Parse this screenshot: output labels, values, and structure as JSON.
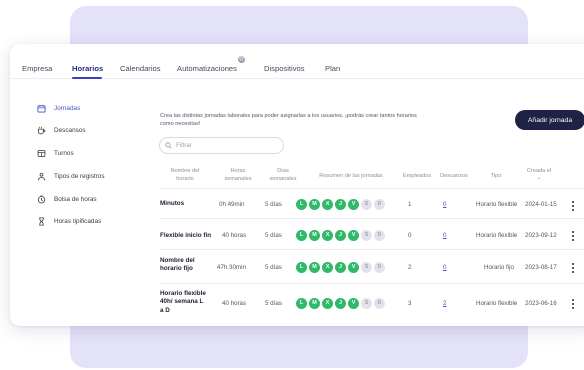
{
  "nav": {
    "tabs": [
      {
        "label": "Empresa"
      },
      {
        "label": "Horarios"
      },
      {
        "label": "Calendarios"
      },
      {
        "label": "Automatizaciones"
      },
      {
        "label": "Dispositivos"
      },
      {
        "label": "Plan"
      }
    ],
    "active_tab": "Horarios",
    "automatizaciones_badge": "@"
  },
  "sidebar": {
    "items": [
      {
        "label": "Jornadas",
        "icon": "calendar-icon"
      },
      {
        "label": "Descansos",
        "icon": "coffee-icon"
      },
      {
        "label": "Turnos",
        "icon": "grid-icon"
      },
      {
        "label": "Tipos de registros",
        "icon": "people-icon"
      },
      {
        "label": "Bolsa de horas",
        "icon": "clock-icon"
      },
      {
        "label": "Horas tipificadas",
        "icon": "hourglass-icon"
      }
    ],
    "active_item": "Jornadas"
  },
  "main": {
    "intro_text": "Crea las distintas jornadas laborales para poder asignarlas a los usuarios, ¡podrás crear tantos horarios como necesitas!",
    "add_button": "Añadir jornada",
    "search_placeholder": "Filtrar",
    "columns": {
      "name": "Nombre del horario",
      "hours": "Horas semanales",
      "days": "Días semanales",
      "summary": "Resumen de las jornadas",
      "employees": "Empleados",
      "breaks": "Descansos",
      "type": "Tipo",
      "created": "Creada el",
      "created_sort": "⌄"
    },
    "day_letters": [
      "L",
      "M",
      "X",
      "J",
      "V",
      "S",
      "D"
    ],
    "rows": [
      {
        "name": "Minutos",
        "hours": "0h 49min",
        "days": "5 días",
        "employees": "1",
        "breaks": "0",
        "type": "Horario flexible",
        "created": "2024-01-15"
      },
      {
        "name": "Flexible inicio fin",
        "hours": "40 horas",
        "days": "5 días",
        "employees": "0",
        "breaks": "0",
        "type": "Horario flexible",
        "created": "2023-09-12"
      },
      {
        "name": "Nombre del horario fijo",
        "hours": "47h 30min",
        "days": "5 días",
        "employees": "2",
        "breaks": "0",
        "type": "Horario fijo",
        "created": "2023-08-17"
      },
      {
        "name": "Horario flexible 40h/ semana L a D",
        "hours": "40 horas",
        "days": "5 días",
        "employees": "3",
        "breaks": "2",
        "type": "Horario flexible",
        "created": "2023-06-16"
      }
    ]
  },
  "colors": {
    "accent": "#3b3fb8",
    "day_on": "#2fb968",
    "day_off": "#e2e2ea",
    "button_dark": "#1f2244",
    "backdrop": "#e4e2f8"
  }
}
